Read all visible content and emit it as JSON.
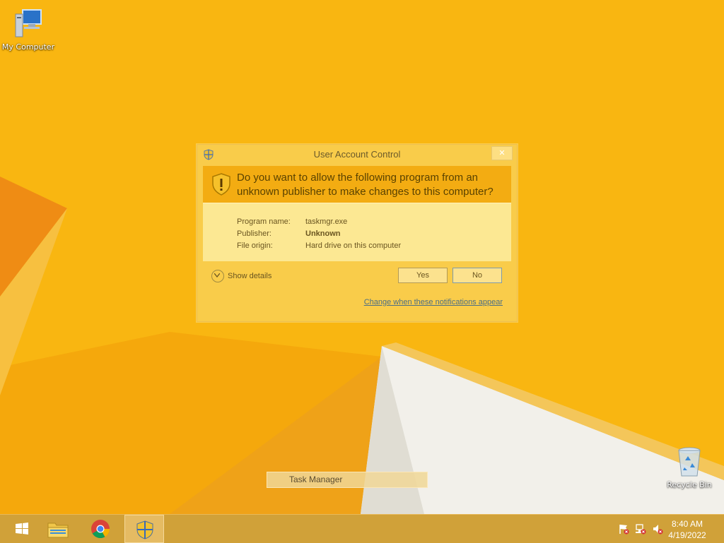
{
  "desktop": {
    "icons": [
      {
        "label": "My Computer"
      },
      {
        "label": "Recycle Bin"
      }
    ]
  },
  "uac": {
    "title": "User Account Control",
    "close_label": "✕",
    "question": "Do you want to allow the following program from an unknown publisher to make changes to this computer?",
    "fields": [
      {
        "label": "Program name:",
        "value": "taskmgr.exe"
      },
      {
        "label": "Publisher:",
        "value": "Unknown"
      },
      {
        "label": "File origin:",
        "value": "Hard drive on this computer"
      }
    ],
    "show_details_label": "Show details",
    "yes_label": "Yes",
    "no_label": "No",
    "change_link": "Change when these notifications appear"
  },
  "taskbar": {
    "thumbnail_label": "Task Manager",
    "buttons": [
      {
        "icon": "windows-logo-icon"
      },
      {
        "icon": "file-explorer-icon"
      },
      {
        "icon": "chrome-icon"
      },
      {
        "icon": "uac-shield-icon"
      }
    ],
    "tray_icons": [
      "action-center-flag-icon",
      "network-icon",
      "speaker-muted-icon"
    ],
    "time": "8:40 AM",
    "date": "4/19/2022"
  },
  "colors": {
    "wallpaper": "#f9b611",
    "uac_header": "#f3ac12",
    "link": "#4b6e86"
  }
}
